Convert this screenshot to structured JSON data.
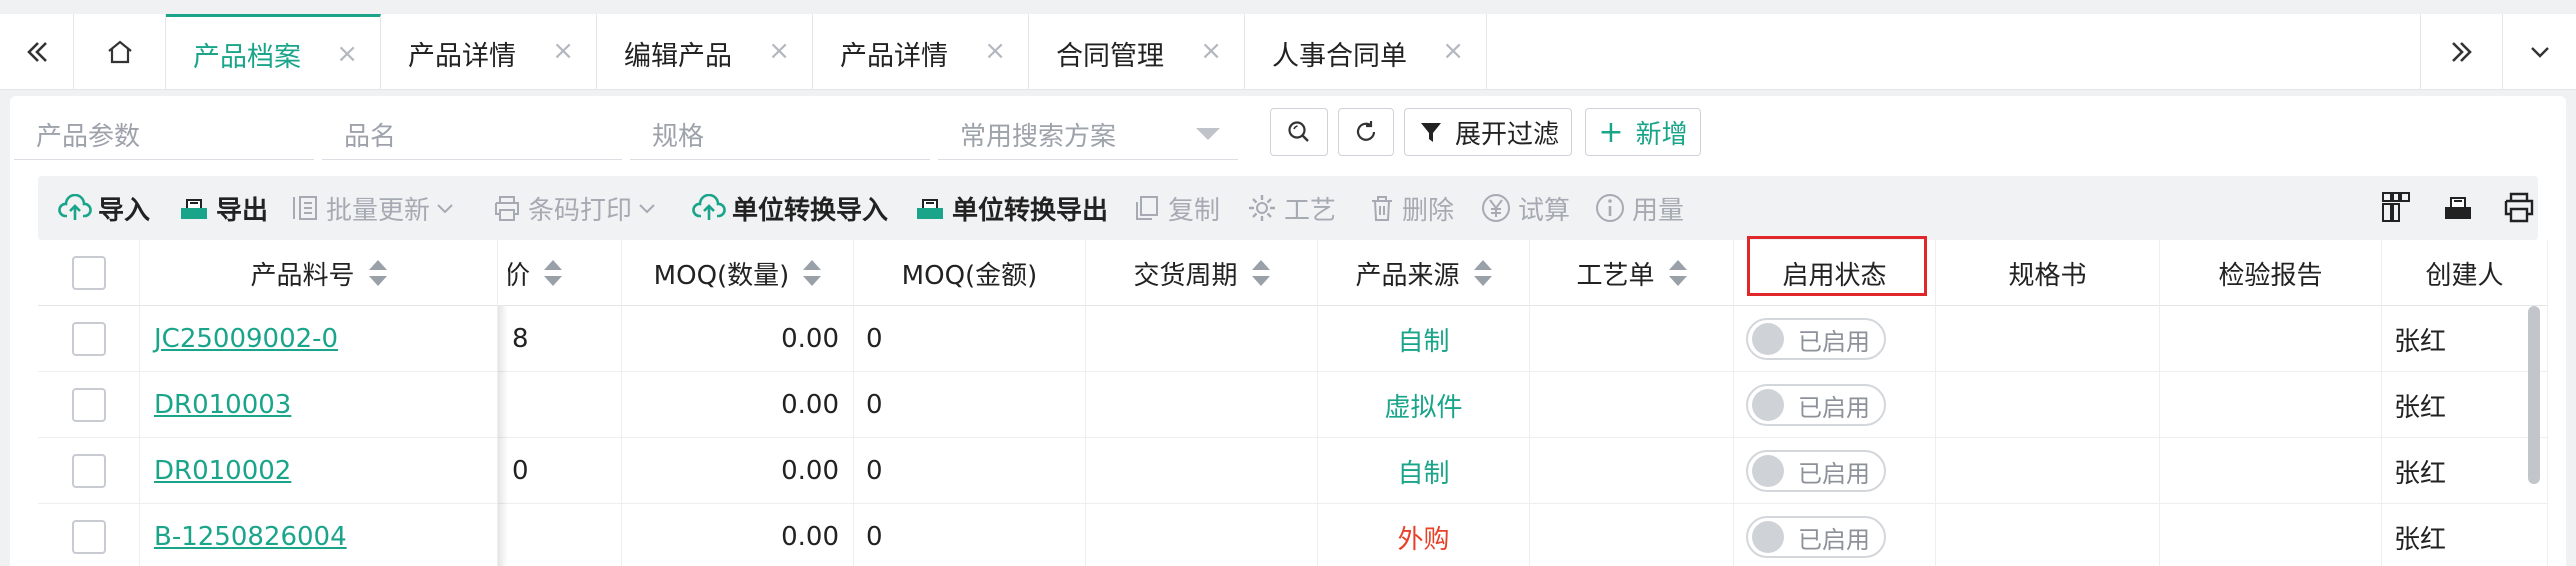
{
  "tabs": {
    "items": [
      {
        "label": "产品档案",
        "closable": true,
        "active": true
      },
      {
        "label": "产品详情",
        "closable": true
      },
      {
        "label": "编辑产品",
        "closable": true
      },
      {
        "label": "产品详情",
        "closable": true
      },
      {
        "label": "合同管理",
        "closable": true
      },
      {
        "label": "人事合同单",
        "closable": true
      }
    ],
    "close_glyph": "×",
    "accent": "#1aa58a"
  },
  "search": {
    "fields": [
      {
        "placeholder": "产品参数"
      },
      {
        "placeholder": "品名"
      },
      {
        "placeholder": "规格"
      },
      {
        "placeholder": "常用搜索方案"
      }
    ],
    "expand_filter_label": "展开过滤",
    "add_label": "新增",
    "add_prefix": "+"
  },
  "toolbar": {
    "items": [
      {
        "label": "导入",
        "icon": "cloud-upload-icon",
        "enabled": true
      },
      {
        "label": "导出",
        "icon": "export-icon",
        "enabled": true
      },
      {
        "label": "批量更新",
        "icon": "batch-update-icon",
        "enabled": false,
        "dropdown": true
      },
      {
        "label": "条码打印",
        "icon": "print-icon",
        "enabled": false,
        "dropdown": true
      },
      {
        "label": "单位转换导入",
        "icon": "cloud-upload-icon",
        "enabled": true
      },
      {
        "label": "单位转换导出",
        "icon": "export-icon",
        "enabled": true
      },
      {
        "label": "复制",
        "icon": "copy-icon",
        "enabled": false
      },
      {
        "label": "工艺",
        "icon": "gear-icon",
        "enabled": false
      },
      {
        "label": "删除",
        "icon": "trash-icon",
        "enabled": false
      },
      {
        "label": "试算",
        "icon": "yen-icon",
        "enabled": false
      },
      {
        "label": "用量",
        "icon": "info-icon",
        "enabled": false
      }
    ],
    "right_icons": [
      "columns-icon",
      "export-icon",
      "print-icon"
    ]
  },
  "table": {
    "columns": [
      {
        "label": "",
        "sortable": false
      },
      {
        "label": "产品料号",
        "sortable": true
      },
      {
        "label": "售价",
        "sortable": true
      },
      {
        "label": "MOQ(数量)",
        "sortable": true
      },
      {
        "label": "MOQ(金额)",
        "sortable": false
      },
      {
        "label": "交货周期",
        "sortable": true
      },
      {
        "label": "产品来源",
        "sortable": true
      },
      {
        "label": "工艺单",
        "sortable": true
      },
      {
        "label": "启用状态",
        "sortable": false
      },
      {
        "label": "规格书",
        "sortable": false
      },
      {
        "label": "检验报告",
        "sortable": false
      },
      {
        "label": "创建人",
        "sortable": false
      }
    ],
    "rows": [
      {
        "code": "JC25009002-0",
        "price_fragment": "8",
        "moq_qty": "0.00",
        "moq_amount": "0",
        "source": "自制",
        "source_color": "#1aa58a",
        "status": "已启用",
        "creator": "张红"
      },
      {
        "code": "DR010003",
        "price_fragment": "",
        "moq_qty": "0.00",
        "moq_amount": "0",
        "source": "虚拟件",
        "source_color": "#1aa58a",
        "status": "已启用",
        "creator": "张红"
      },
      {
        "code": "DR010002",
        "price_fragment": "0",
        "moq_qty": "0.00",
        "moq_amount": "0",
        "source": "自制",
        "source_color": "#1aa58a",
        "status": "已启用",
        "creator": "张红"
      },
      {
        "code": "B-1250826004",
        "price_fragment": "",
        "moq_qty": "0.00",
        "moq_amount": "0",
        "source": "外购",
        "source_color": "#e8412a",
        "status": "已启用",
        "creator": "张红"
      }
    ],
    "highlight_color": "#e0282a"
  }
}
